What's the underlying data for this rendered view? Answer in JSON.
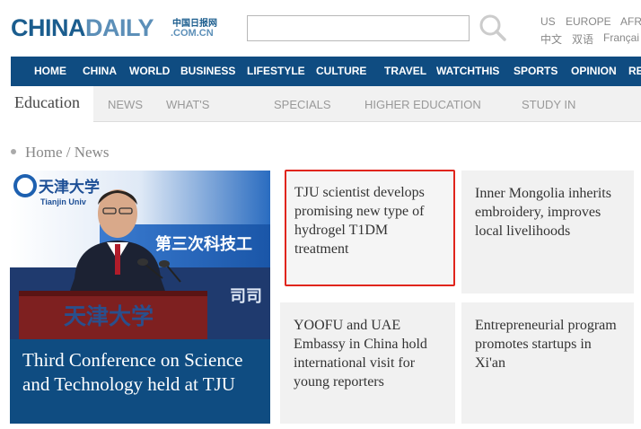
{
  "header": {
    "logo_main": "CHINA",
    "logo_accent": "DAILY",
    "logo_cn": "中国日报网",
    "logo_domain": ".COM.CN",
    "search_placeholder": "",
    "lang_row1": [
      "US",
      "EUROPE",
      "AFR"
    ],
    "lang_row2": [
      "中文",
      "双语",
      "Françai"
    ]
  },
  "main_nav": [
    "HOME",
    "CHINA",
    "WORLD",
    "BUSINESS",
    "LIFESTYLE",
    "CULTURE",
    "TRAVEL",
    "WATCHTHIS",
    "SPORTS",
    "OPINION",
    "RE"
  ],
  "sub_nav": {
    "section": "Education",
    "items": [
      "NEWS",
      "WHAT'S",
      "SPECIALS",
      "HIGHER EDUCATION",
      "STUDY IN"
    ]
  },
  "breadcrumb": "Home / News",
  "hero": {
    "caption": "Third Conference on Science and Technology held at TJU",
    "image_text": {
      "university_cn": "天津大学",
      "university_en": "Tianjin Univ",
      "banner_cn": "第三次科技工",
      "banner_cn2": "司司",
      "podium_cn": "天津大学"
    }
  },
  "cards": [
    {
      "title": "TJU scientist develops promising new type of hydrogel T1DM treatment"
    },
    {
      "title": "Inner Mongolia inherits embroidery, improves local livelihoods"
    },
    {
      "title": "YOOFU and UAE Embassy in China hold international visit for young reporters"
    },
    {
      "title": "Entrepreneurial program promotes startups in Xi'an"
    }
  ],
  "colors": {
    "brand_blue": "#0f4c81",
    "highlight_red": "#e0251c",
    "banner_blue": "#1d60b0"
  }
}
